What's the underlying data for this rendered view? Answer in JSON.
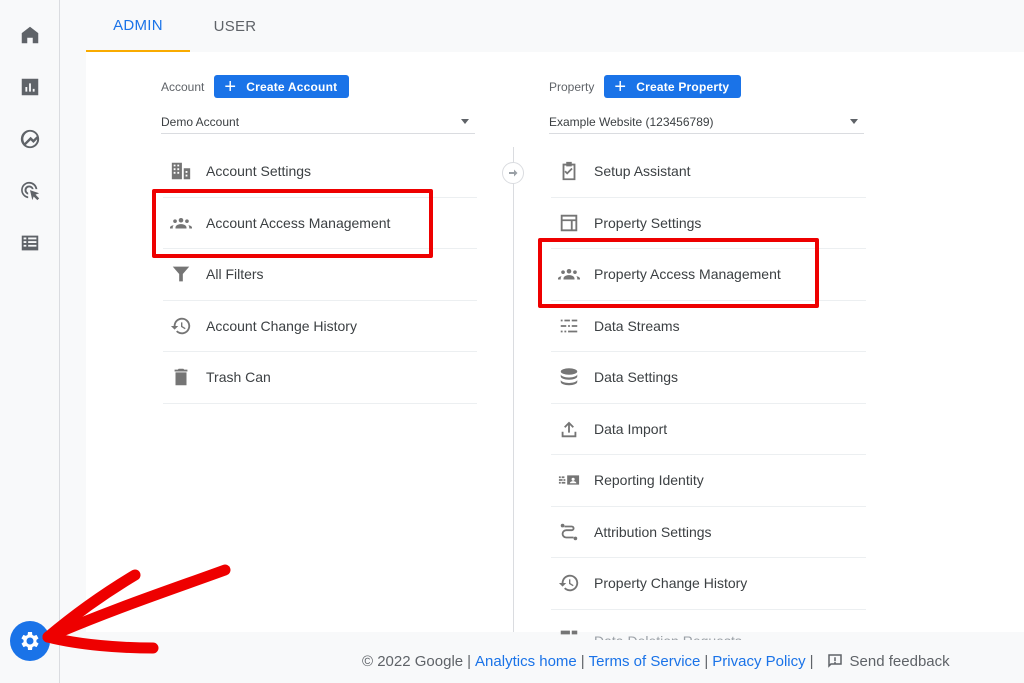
{
  "tabs": [
    {
      "label": "ADMIN",
      "active": true
    },
    {
      "label": "USER",
      "active": false
    }
  ],
  "nav_rail": {
    "items": [
      {
        "name": "home",
        "icon": "home-icon"
      },
      {
        "name": "reports",
        "icon": "bar-chart-icon"
      },
      {
        "name": "explore",
        "icon": "explore-icon"
      },
      {
        "name": "advertising",
        "icon": "target-cursor-icon"
      },
      {
        "name": "configure",
        "icon": "list-icon"
      }
    ],
    "settings_icon": "gear-icon"
  },
  "account": {
    "label": "Account",
    "create_button": "Create Account",
    "selected": "Demo Account",
    "items": [
      {
        "label": "Account Settings",
        "icon": "building-icon"
      },
      {
        "label": "Account Access Management",
        "icon": "people-icon",
        "highlighted": true
      },
      {
        "label": "All Filters",
        "icon": "filter-icon"
      },
      {
        "label": "Account Change History",
        "icon": "history-icon"
      },
      {
        "label": "Trash Can",
        "icon": "trash-icon"
      }
    ]
  },
  "property": {
    "label": "Property",
    "create_button": "Create Property",
    "selected": "Example Website (123456789)",
    "items": [
      {
        "label": "Setup Assistant",
        "icon": "clipboard-check-icon"
      },
      {
        "label": "Property Settings",
        "icon": "layout-icon"
      },
      {
        "label": "Property Access Management",
        "icon": "people-icon",
        "highlighted": true
      },
      {
        "label": "Data Streams",
        "icon": "streams-icon"
      },
      {
        "label": "Data Settings",
        "icon": "database-icon"
      },
      {
        "label": "Data Import",
        "icon": "upload-icon"
      },
      {
        "label": "Reporting Identity",
        "icon": "reporting-identity-icon"
      },
      {
        "label": "Attribution Settings",
        "icon": "attribution-icon"
      },
      {
        "label": "Property Change History",
        "icon": "history-icon"
      },
      {
        "label": "Data Deletion Requests",
        "icon": "data-deletion-icon"
      }
    ]
  },
  "footer": {
    "copyright": "© 2022 Google",
    "links": [
      "Analytics home",
      "Terms of Service",
      "Privacy Policy"
    ],
    "separator": "|",
    "feedback": "Send feedback"
  },
  "colors": {
    "accent": "#1a73e8",
    "tab_indicator": "#f9ab00",
    "highlight": "#ee0000"
  }
}
